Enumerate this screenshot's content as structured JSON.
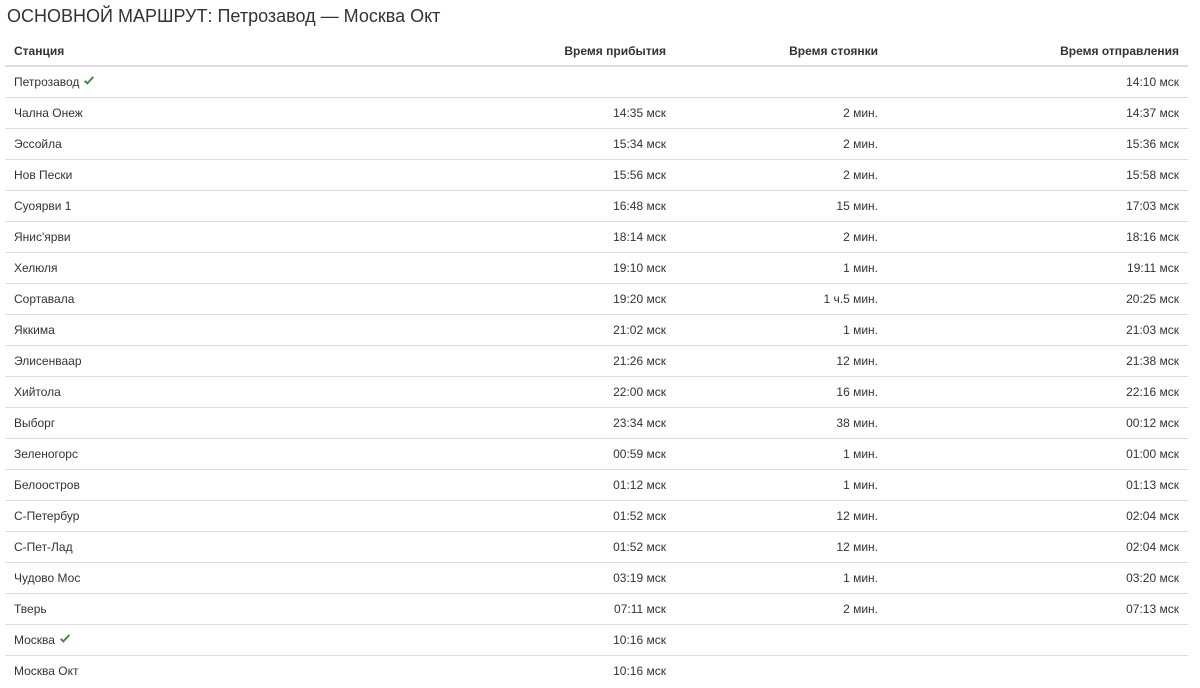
{
  "route": {
    "title": "ОСНОВНОЙ МАРШРУТ: Петрозавод — Москва Окт"
  },
  "colors": {
    "check": "#3c8d3c",
    "border": "#dddddd",
    "muted_text": "#777777"
  },
  "table": {
    "headers": {
      "station": "Станция",
      "arrival": "Время прибытия",
      "stop": "Время стоянки",
      "departure": "Время отправления"
    },
    "rows": [
      {
        "station": "Петрозавод",
        "check": true,
        "arrival": "",
        "stop": "",
        "departure": "14:10 мск"
      },
      {
        "station": "Чална Онеж",
        "arrival": "14:35 мск",
        "stop": "2 мин.",
        "departure": "14:37 мск"
      },
      {
        "station": "Эссойла",
        "arrival": "15:34 мск",
        "stop": "2 мин.",
        "departure": "15:36 мск"
      },
      {
        "station": "Нов Пески",
        "arrival": "15:56 мск",
        "stop": "2 мин.",
        "departure": "15:58 мск"
      },
      {
        "station": "Суоярви 1",
        "arrival": "16:48 мск",
        "stop": "15 мин.",
        "departure": "17:03 мск"
      },
      {
        "station": "Янис'ярви",
        "arrival": "18:14 мск",
        "stop": "2 мин.",
        "departure": "18:16 мск"
      },
      {
        "station": "Хелюля",
        "arrival": "19:10 мск",
        "stop": "1 мин.",
        "departure": "19:11 мск"
      },
      {
        "station": "Сортавала",
        "arrival": "19:20 мск",
        "stop": "1 ч.5 мин.",
        "departure": "20:25 мск"
      },
      {
        "station": "Яккима",
        "arrival": "21:02 мск",
        "stop": "1 мин.",
        "departure": "21:03 мск"
      },
      {
        "station": "Элисенваар",
        "arrival": "21:26 мск",
        "stop": "12 мин.",
        "departure": "21:38 мск"
      },
      {
        "station": "Хийтола",
        "arrival": "22:00 мск",
        "stop": "16 мин.",
        "departure": "22:16 мск"
      },
      {
        "station": "Выборг",
        "arrival": "23:34 мск",
        "stop": "38 мин.",
        "departure": "00:12 мск"
      },
      {
        "station": "Зеленогорс",
        "arrival": "00:59 мск",
        "stop": "1 мин.",
        "departure": "01:00 мск"
      },
      {
        "station": "Белоостров",
        "arrival": "01:12 мск",
        "stop": "1 мин.",
        "departure": "01:13 мск"
      },
      {
        "station": "С-Петербур",
        "arrival": "01:52 мск",
        "stop": "12 мин.",
        "departure": "02:04 мск"
      },
      {
        "station": "С-Пет-Лад",
        "arrival": "01:52 мск",
        "stop": "12 мин.",
        "departure": "02:04 мск"
      },
      {
        "station": "Чудово Мос",
        "arrival": "03:19 мск",
        "stop": "1 мин.",
        "departure": "03:20 мск"
      },
      {
        "station": "Тверь",
        "arrival": "07:11 мск",
        "stop": "2 мин.",
        "departure": "07:13 мск"
      },
      {
        "station": "Москва",
        "check": true,
        "arrival": "10:16 мск",
        "stop": "",
        "departure": ""
      },
      {
        "station": "Москва Окт",
        "muted": true,
        "arrival": "10:16 мск",
        "stop": "",
        "departure": ""
      }
    ]
  }
}
